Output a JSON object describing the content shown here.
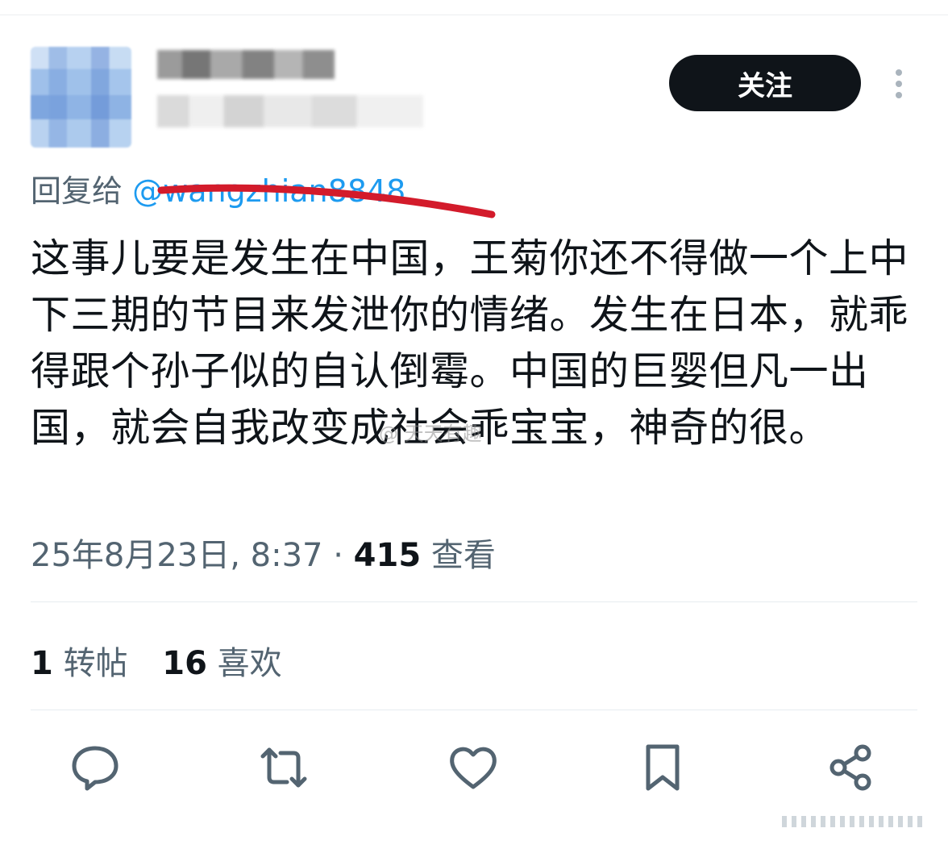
{
  "follow_label": "关注",
  "reply": {
    "prefix": "回复给",
    "handle": "@wangzhian8848"
  },
  "tweet_text": "这事儿要是发生在中国，王菊你还不得做一个上中下三期的节目来发泄你的情绪。发生在日本，就乖得跟个孙子似的自认倒霉。中国的巨婴但凡一出国，就会自我改变成社会乖宝宝，神奇的很。",
  "meta": {
    "timestamp": "25年8月23日, 8:37",
    "separator": "·",
    "views_count": "415",
    "views_label": "查看"
  },
  "stats": {
    "retweets_count": "1",
    "retweets_label": "转帖",
    "likes_count": "16",
    "likes_label": "喜欢"
  },
  "watermark": "@ 天天有趣",
  "icons": [
    "more-icon",
    "reply-icon",
    "retweet-icon",
    "like-icon",
    "bookmark-icon",
    "share-icon"
  ],
  "colors": {
    "accent": "#1d9bf0",
    "text": "#0f1419",
    "secondary": "#536471",
    "button": "#0f1419",
    "annotation": "#d31b2b"
  }
}
